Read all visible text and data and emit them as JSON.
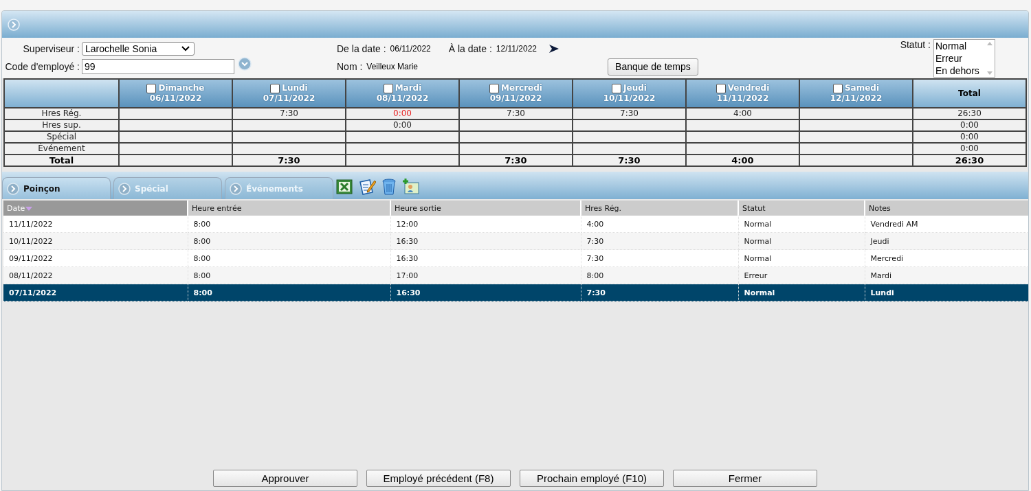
{
  "form": {
    "supervisor": {
      "label": "Superviseur :",
      "value": "Larochelle Sonia"
    },
    "employee_code": {
      "label": "Code d'employé :",
      "value": "99"
    },
    "from_date": {
      "label": "De la date :",
      "value": "06/11/2022"
    },
    "to_date": {
      "label": "À la date :",
      "value": "12/11/2022"
    },
    "name": {
      "label": "Nom :",
      "value": "Veilleux Marie"
    },
    "time_bank_button": "Banque de temps",
    "status": {
      "label": "Statut :",
      "options": [
        {
          "label": "Normal",
          "selected": false
        },
        {
          "label": "Erreur",
          "selected": false
        },
        {
          "label": "En dehors",
          "selected": false
        }
      ]
    }
  },
  "summary": {
    "days": [
      {
        "day": "Dimanche",
        "date": "06/11/2022",
        "checked": false
      },
      {
        "day": "Lundi",
        "date": "07/11/2022",
        "checked": false
      },
      {
        "day": "Mardi",
        "date": "08/11/2022",
        "checked": false
      },
      {
        "day": "Mercredi",
        "date": "09/11/2022",
        "checked": false
      },
      {
        "day": "Jeudi",
        "date": "10/11/2022",
        "checked": false
      },
      {
        "day": "Vendredi",
        "date": "11/11/2022",
        "checked": false
      },
      {
        "day": "Samedi",
        "date": "12/11/2022",
        "checked": false
      }
    ],
    "total_header": "Total",
    "rows": [
      {
        "label": "Hres Rég.",
        "kind": "normal",
        "cells": [
          null,
          {
            "value": "7:30",
            "alert": false
          },
          {
            "value": "0:00",
            "alert": true
          },
          {
            "value": "7:30",
            "alert": false
          },
          {
            "value": "7:30",
            "alert": false
          },
          {
            "value": "4:00",
            "alert": false
          },
          null
        ],
        "total": "26:30"
      },
      {
        "label": "Hres sup.",
        "kind": "normal",
        "cells": [
          null,
          null,
          {
            "value": "0:00",
            "alert": false
          },
          null,
          null,
          null,
          null
        ],
        "total": "0:00"
      },
      {
        "label": "Spécial",
        "kind": "normal",
        "cells": [
          null,
          null,
          null,
          null,
          null,
          null,
          null
        ],
        "total": "0:00"
      },
      {
        "label": "Événement",
        "kind": "normal",
        "cells": [
          null,
          null,
          null,
          null,
          null,
          null,
          null
        ],
        "total": "0:00"
      },
      {
        "label": "Total",
        "kind": "total",
        "cells": [
          null,
          {
            "value": "7:30",
            "alert": false
          },
          null,
          {
            "value": "7:30",
            "alert": false
          },
          {
            "value": "7:30",
            "alert": false
          },
          {
            "value": "4:00",
            "alert": false
          },
          null
        ],
        "total": "26:30"
      }
    ]
  },
  "tabs": [
    {
      "label": "Poinçon",
      "selected": true
    },
    {
      "label": "Spécial",
      "selected": false
    },
    {
      "label": "Événements",
      "selected": false
    }
  ],
  "grid": {
    "columns": [
      {
        "label": "Date",
        "sorted": true
      },
      {
        "label": "Heure entrée",
        "sorted": false
      },
      {
        "label": "Heure sortie",
        "sorted": false
      },
      {
        "label": "Hres Rég.",
        "sorted": false
      },
      {
        "label": "Statut",
        "sorted": false
      },
      {
        "label": "Notes",
        "sorted": false
      }
    ],
    "rows": [
      {
        "cells": [
          "11/11/2022",
          "8:00",
          "12:00",
          "4:00",
          "Normal",
          "Vendredi AM"
        ],
        "selected": false
      },
      {
        "cells": [
          "10/11/2022",
          "8:00",
          "16:30",
          "7:30",
          "Normal",
          "Jeudi"
        ],
        "selected": false
      },
      {
        "cells": [
          "09/11/2022",
          "8:00",
          "16:30",
          "7:30",
          "Normal",
          "Mercredi"
        ],
        "selected": false
      },
      {
        "cells": [
          "08/11/2022",
          "8:00",
          "17:00",
          "8:00",
          "Erreur",
          "Mardi"
        ],
        "selected": false
      },
      {
        "cells": [
          "07/11/2022",
          "8:00",
          "16:30",
          "7:30",
          "Normal",
          "Lundi"
        ],
        "selected": true
      }
    ]
  },
  "buttons": [
    "Approuver",
    "Employé précédent (F8)",
    "Prochain employé (F10)",
    "Fermer"
  ]
}
